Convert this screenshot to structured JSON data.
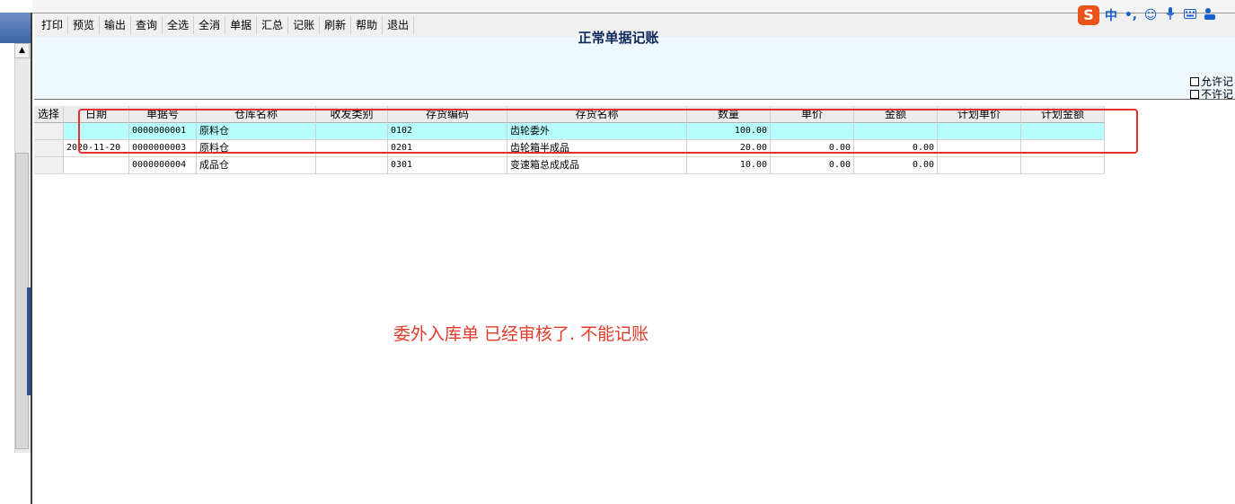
{
  "toolbar": {
    "items": [
      "打印",
      "预览",
      "输出",
      "查询",
      "全选",
      "全消",
      "单据",
      "汇总",
      "记账",
      "刷新",
      "帮助",
      "退出"
    ]
  },
  "ime": {
    "logo": "S",
    "mode": "中",
    "punct": "•,"
  },
  "page": {
    "title": "正常单据记账",
    "options": [
      "允许记",
      "不许记"
    ]
  },
  "table": {
    "headers": [
      "选择",
      "日期",
      "单据号",
      "仓库名称",
      "收发类别",
      "存货编码",
      "存货名称",
      "数量",
      "单价",
      "金额",
      "计划单价",
      "计划金额"
    ],
    "rows": [
      {
        "select": "",
        "date": "",
        "doc_no": "0000000001",
        "warehouse": "原料仓",
        "io_type": "",
        "item_code": "0102",
        "item_name": "齿轮委外",
        "qty": "100.00",
        "price": "",
        "amount": "",
        "plan_price": "",
        "plan_amount": ""
      },
      {
        "select": "",
        "date": "2020-11-20",
        "doc_no": "0000000003",
        "warehouse": "原料仓",
        "io_type": "",
        "item_code": "0201",
        "item_name": "齿轮箱半成品",
        "qty": "20.00",
        "price": "0.00",
        "amount": "0.00",
        "plan_price": "",
        "plan_amount": ""
      },
      {
        "select": "",
        "date": "",
        "doc_no": "0000000004",
        "warehouse": "成品仓",
        "io_type": "",
        "item_code": "0301",
        "item_name": "变速箱总成成品",
        "qty": "10.00",
        "price": "0.00",
        "amount": "0.00",
        "plan_price": "",
        "plan_amount": ""
      }
    ]
  },
  "annotation": {
    "text": "委外入库单 已经审核了. 不能记账",
    "color": "#e23a2a"
  }
}
